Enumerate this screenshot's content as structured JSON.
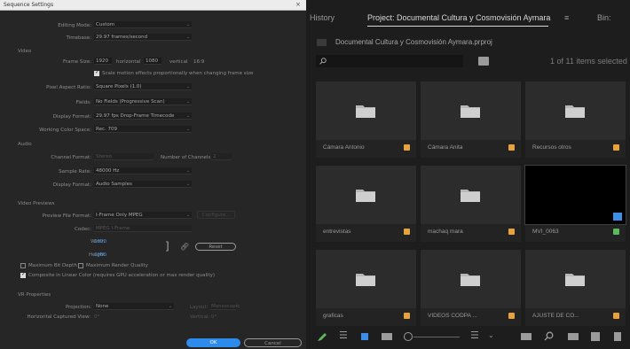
{
  "dialog": {
    "title": "Sequence Settings",
    "close": "×",
    "editing_mode_label": "Editing Mode:",
    "editing_mode_value": "Custom",
    "timebase_label": "Timebase:",
    "timebase_value": "29.97 frames/second",
    "video_section": "Video",
    "frame_size_label": "Frame Size:",
    "frame_width": "1920",
    "horizontal_label": "horizontal",
    "frame_height": "1080",
    "vertical_label": "vertical",
    "aspect": "16:9",
    "scale_checkbox_label": "Scale motion effects proportionally when changing frame size",
    "pixel_aspect_label": "Pixel Aspect Ratio:",
    "pixel_aspect_value": "Square Pixels (1.0)",
    "fields_label": "Fields:",
    "fields_value": "No Fields (Progressive Scan)",
    "display_format_label": "Display Format:",
    "display_format_value": "29.97 fps Drop-Frame Timecode",
    "working_color_label": "Working Color Space:",
    "working_color_value": "Rec. 709",
    "audio_section": "Audio",
    "channel_format_label": "Channel Format:",
    "channel_format_value": "Stereo",
    "num_channels_label": "Number of Channels:",
    "num_channels_value": "2",
    "sample_rate_label": "Sample Rate:",
    "sample_rate_value": "48000 Hz",
    "audio_display_label": "Display Format:",
    "audio_display_value": "Audio Samples",
    "previews_section": "Video Previews",
    "preview_format_label": "Preview File Format:",
    "preview_format_value": "I-Frame Only MPEG",
    "configure_label": "Configure...",
    "codec_label": "Codec:",
    "codec_value": "MPEG I-Frame",
    "width_label": "Width:",
    "width_value": "1920",
    "height_label": "Height:",
    "height_value": "1080",
    "reset_label": "Reset",
    "max_bit_depth_label": "Maximum Bit Depth",
    "max_render_label": "Maximum Render Quality",
    "composite_label": "Composite in Linear Color (requires GPU acceleration or max render quality)",
    "vr_section": "VR Properties",
    "projection_label": "Projection:",
    "projection_value": "None",
    "layout_label": "Layout:",
    "layout_value": "Monoscopic",
    "h_fov_label": "Horizontal Captured View:",
    "h_fov_value": "0°",
    "vertical_fov_label": "Vertical:",
    "vertical_fov_value": "0°",
    "ok_label": "OK",
    "cancel_label": "Cancel"
  },
  "panel": {
    "tabs": [
      {
        "label": "History"
      },
      {
        "label": "Project: Documental Cultura y Cosmovisión Aymara"
      },
      {
        "label": "Bin:"
      }
    ],
    "menu_icon": "≡",
    "project_file": "Documental Cultura y Cosmovisión Aymara.prproj",
    "search_placeholder": "",
    "items_count": "1 of 11 items selected",
    "bins": [
      {
        "name": "Cámara Antonio",
        "chip": "#e6a23c",
        "type": "folder"
      },
      {
        "name": "Cámara Anita",
        "chip": "#e6a23c",
        "type": "folder"
      },
      {
        "name": "Recursos otros",
        "chip": "#e6a23c",
        "type": "folder"
      },
      {
        "name": "entrevistas",
        "chip": "#e6a23c",
        "type": "folder"
      },
      {
        "name": "machaq mara",
        "chip": "#e6a23c",
        "type": "folder"
      },
      {
        "name": "MVI_0063",
        "chip": "#5bb85d",
        "type": "clip"
      },
      {
        "name": "graficas",
        "chip": "#e6a23c",
        "type": "folder"
      },
      {
        "name": "VIDEOS CODPA ...",
        "chip": "#e6a23c",
        "type": "folder"
      },
      {
        "name": "AJUSTE DE CO...",
        "chip": "#e6a23c",
        "type": "folder"
      }
    ]
  },
  "colors": {
    "accent_blue": "#2d8ceb",
    "label_orange": "#e6a23c",
    "label_green": "#5bb85d"
  }
}
